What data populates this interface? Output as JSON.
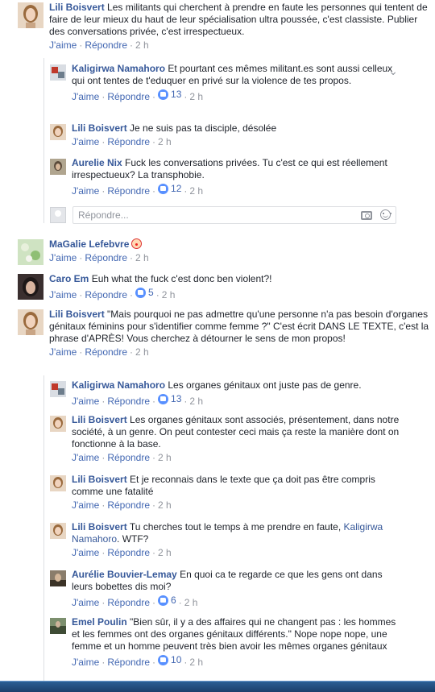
{
  "labels": {
    "like": "J'aime",
    "reply": "Répondre",
    "sep": "·"
  },
  "reply_box": {
    "placeholder": "Répondre..."
  },
  "comments": [
    {
      "author": "Lili Boisvert",
      "text": "Les militants qui cherchent à prendre en faute les personnes qui tentent de faire de leur mieux du haut de leur spécialisation ultra poussée, c'est classiste. Publier des conversations privée, c'est irrespectueux.",
      "time": "2 h"
    },
    {
      "author": "Kaligirwa Namahoro",
      "text": "Et pourtant ces mêmes militant.es sont aussi celleux qui ont tentes de t'eduquer en privé sur la violence de tes propos.",
      "likes": "13",
      "time": "2 h"
    },
    {
      "author": "Lili Boisvert",
      "text": "Je ne suis pas ta disciple, désolée",
      "time": "2 h"
    },
    {
      "author": "Aurelie Nix",
      "text": "Fuck les conversations privées. Tu c'est ce qui est réellement irrespectueux? La transphobie.",
      "likes": "12",
      "time": "2 h"
    },
    {
      "author": "MaGalie Lefebvre",
      "text": "",
      "time": "2 h"
    },
    {
      "author": "Caro Em",
      "text": "Euh what the fuck c'est donc ben violent?!",
      "likes": "5",
      "time": "2 h"
    },
    {
      "author": "Lili Boisvert",
      "text": "\"Mais pourquoi ne pas admettre qu'une personne n'a pas besoin d'organes génitaux féminins pour s'identifier comme femme ?\" C'est écrit DANS LE TEXTE, c'est la phrase d'APRÈS! Vous cherchez à détourner le sens de mon propos!",
      "time": "2 h"
    },
    {
      "author": "Kaligirwa Namahoro",
      "text": "Les organes génitaux ont juste pas de genre.",
      "likes": "13",
      "time": "2 h"
    },
    {
      "author": "Lili Boisvert",
      "text": "Les organes génitaux sont associés, présentement, dans notre société, à un genre. On peut contester ceci mais ça reste la manière dont on fonctionne à la base.",
      "time": "2 h"
    },
    {
      "author": "Lili Boisvert",
      "text": "Et je reconnais dans le texte que ça doit pas être compris comme une fatalité",
      "time": "2 h"
    },
    {
      "author": "Lili Boisvert",
      "text": "Tu cherches tout le temps à me prendre en faute, ",
      "mention": "Kaligirwa Namahoro",
      "text_after": ". WTF?",
      "time": "2 h"
    },
    {
      "author": "Aurélie Bouvier-Lemay",
      "text": "En quoi ca te regarde ce que les gens ont dans leurs bobettes dis moi?",
      "likes": "6",
      "time": "2 h"
    },
    {
      "author": "Emel Poulin",
      "text": "\"Bien sûr, il y a des affaires qui ne changent pas : les hommes et les femmes ont des organes génitaux différents.\" Nope nope nope, une femme et un homme peuvent très bien avoir les mêmes organes génitaux",
      "likes": "10",
      "time": "2 h"
    }
  ]
}
